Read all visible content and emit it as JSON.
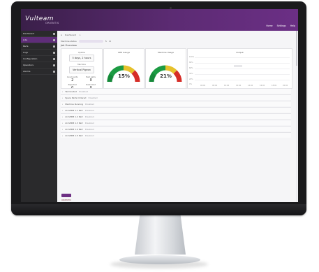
{
  "app": {
    "logo_text": "Vulteam",
    "logo_subtext": "ORIENTIS",
    "top_actions": [
      "Home",
      "Settings",
      "Help"
    ]
  },
  "sidebar": {
    "items": [
      {
        "label": "Dashboard",
        "active": false
      },
      {
        "label": "Jobs",
        "active": true
      },
      {
        "label": "Parts",
        "active": false
      },
      {
        "label": "Logs",
        "active": false
      },
      {
        "label": "Configuration",
        "active": false
      },
      {
        "label": "Operators",
        "active": false
      },
      {
        "label": "Alarms",
        "active": false
      }
    ]
  },
  "breadcrumb": {
    "items": [
      "Dashboard",
      ">"
    ]
  },
  "toolbar": {
    "filter_label": "Machine status",
    "refresh_label": "↻",
    "settings_label": "⚙"
  },
  "panel": {
    "title": "Job Overview"
  },
  "summary_card": {
    "title": "Uptime",
    "uptime_value": "5 days, 2 hours",
    "machine_label": "Machine",
    "machine_value": "Vertical Pigeon",
    "stats": [
      {
        "label": "Good parts",
        "value": "2"
      },
      {
        "label": "Bad parts",
        "value": "0"
      },
      {
        "label": "Rejected",
        "value": "0"
      },
      {
        "label": "Reworked",
        "value": "0"
      }
    ]
  },
  "gauges": [
    {
      "title": "OEE Gauge",
      "value_text": "15%",
      "value": 15
    },
    {
      "title": "Machine Usage",
      "value_text": "21%",
      "value": 21
    }
  ],
  "chart_card": {
    "title": "Output",
    "y_labels": [
      "100%",
      "80%",
      "60%",
      "40%",
      "20%",
      "0%"
    ],
    "x_labels": [
      "06:00",
      "08:00",
      "10:00",
      "12:00",
      "14:00",
      "16:00",
      "18:00",
      "20:00"
    ]
  },
  "list": {
    "items": [
      {
        "label": "Terminated",
        "meta": "Disabled"
      },
      {
        "label": "Spare Parts Ordered",
        "meta": "Disabled"
      },
      {
        "label": "Machine Running",
        "meta": "Disabled"
      },
      {
        "label": "LC-SPDB 1.1 Part",
        "meta": "Disabled"
      },
      {
        "label": "LC-SPDB 1.2 Part",
        "meta": "Disabled"
      },
      {
        "label": "LC-SPDB 1.3 Part",
        "meta": "Disabled"
      },
      {
        "label": "LC-SPDB 1.4 Part",
        "meta": "Disabled"
      },
      {
        "label": "LC-SPDB 1.5 Part",
        "meta": "Disabled"
      }
    ]
  },
  "footer": {
    "brand": "ORIENTIS"
  },
  "colors": {
    "brand": "#5c2b73",
    "gauge_green": "#1c9b43",
    "gauge_yellow": "#e6c12c",
    "gauge_red": "#d62d27"
  }
}
